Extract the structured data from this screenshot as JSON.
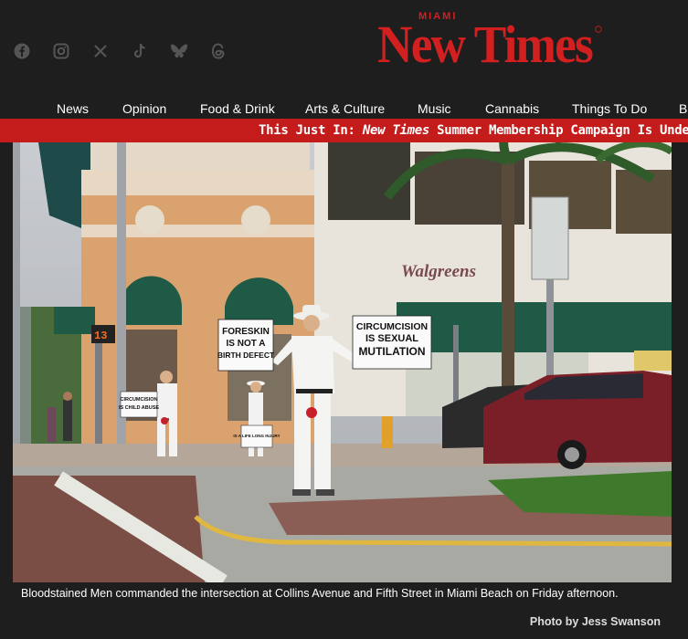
{
  "header": {
    "logo_small": "MIAMI",
    "logo_main": "New Times",
    "social_icons": [
      "facebook-icon",
      "instagram-icon",
      "x-icon",
      "tiktok-icon",
      "bluesky-icon",
      "threads-icon"
    ]
  },
  "nav": {
    "items": [
      "News",
      "Opinion",
      "Food & Drink",
      "Arts & Culture",
      "Music",
      "Cannabis",
      "Things To Do",
      "Be"
    ]
  },
  "ticker": {
    "prefix": "This Just In: ",
    "emphasis": "New Times",
    "suffix": " Summer Membership Campaign Is Under W"
  },
  "photo": {
    "store_sign": "Walgreens",
    "sign_left": "FORESKIN IS NOT A BIRTH DEFECT",
    "sign_left_1": "FORESKIN",
    "sign_left_2": "IS NOT A",
    "sign_left_3": "BIRTH DEFECT",
    "sign_right_1": "CIRCUMCISION",
    "sign_right_2": "IS SEXUAL",
    "sign_right_3": "MUTILATION",
    "sign_small_1": "CIRCUMCISION",
    "sign_small_2": "IS CHILD ABUSE",
    "sign_small_3": "IS A LIFE LONG INJURY"
  },
  "caption": "Bloodstained Men commanded the intersection at Collins Avenue and Fifth Street in Miami Beach on Friday afternoon.",
  "credit": "Photo by Jess Swanson",
  "colors": {
    "brand_red": "#d21f1f",
    "ticker_red": "#c41b1b",
    "bg": "#1e1e1e"
  }
}
